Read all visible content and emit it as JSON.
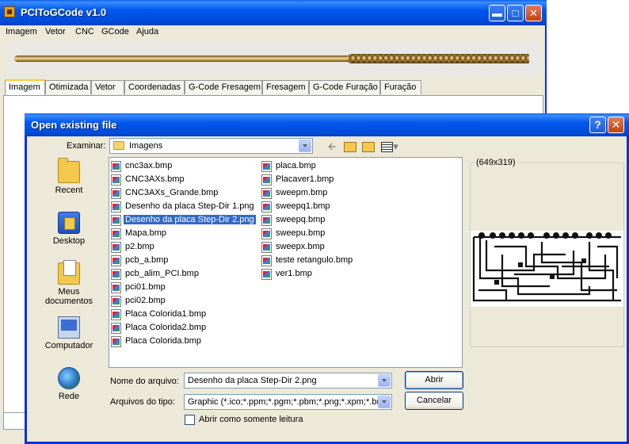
{
  "app": {
    "title": "PCIToGCode  v1.0",
    "menu": [
      "Imagem",
      "Vetor",
      "CNC",
      "GCode",
      "Ajuda"
    ],
    "tabs": [
      "Imagem",
      "Otimizada",
      "Vetor",
      "Coordenadas",
      "G-Code Fresagem",
      "Fresagem",
      "G-Code Furação",
      "Furação"
    ],
    "active_tab": "Imagem"
  },
  "dialog": {
    "title": "Open existing file",
    "help_symbol": "?",
    "close_symbol": "✕",
    "look_in_label": "Examinar:",
    "look_in_value": "Imagens",
    "places": [
      "Recent",
      "Desktop",
      "Meus documentos",
      "Computador",
      "Rede"
    ],
    "files_col1": [
      "cnc3ax.bmp",
      "CNC3AXs.bmp",
      "CNC3AXs_Grande.bmp",
      "Desenho  da placa Step-Dir 1.png",
      "Desenho  da placa Step-Dir 2.png",
      "Mapa.bmp",
      "p2.bmp",
      "pcb_a.bmp",
      "pcb_alim_PCI.bmp",
      "pci01.bmp",
      "pci02.bmp",
      "Placa Colorida1.bmp",
      "Placa Colorida2.bmp",
      "Placa Colorida.bmp"
    ],
    "files_col2": [
      "placa.bmp",
      "Placaver1.bmp",
      "sweepm.bmp",
      "sweepq1.bmp",
      "sweepq.bmp",
      "sweepu.bmp",
      "sweepx.bmp",
      "teste retangulo.bmp",
      "ver1.bmp"
    ],
    "selected_file": "Desenho  da placa Step-Dir 2.png",
    "preview_dims": "(649x319)",
    "filename_label": "Nome do arquivo:",
    "filename_value": "Desenho  da placa Step-Dir 2.png",
    "filetype_label": "Arquivos do tipo:",
    "filetype_value": "Graphic (*.ico;*.ppm;*.pgm;*.pbm;*.png;*.xpm;*.bmp",
    "open_button": "Abrir",
    "cancel_button": "Cancelar",
    "readonly_label": "Abrir como somente leitura",
    "readonly_checked": false
  }
}
